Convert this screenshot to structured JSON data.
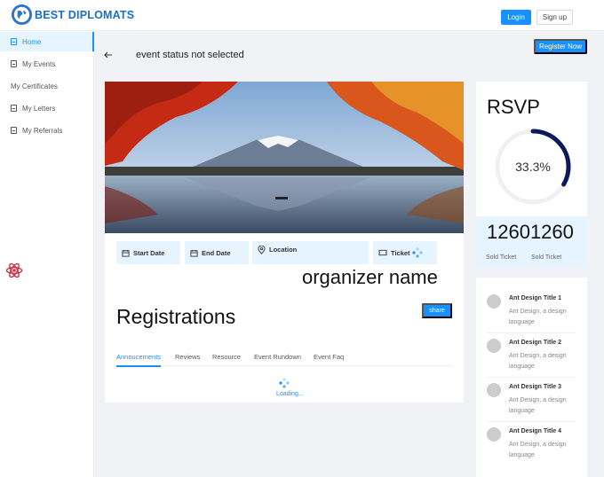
{
  "header": {
    "brand": "BEST DIPLOMATS",
    "login_label": "Login",
    "signup_label": "Sign up"
  },
  "sidebar": {
    "items": [
      {
        "label": "Home",
        "icon": "document-icon",
        "active": true
      },
      {
        "label": "My Events",
        "icon": "document-icon",
        "active": false
      },
      {
        "label": "My Certificates",
        "icon": "",
        "active": false
      },
      {
        "label": "My Letters",
        "icon": "document-icon",
        "active": false
      },
      {
        "label": "My Referrals",
        "icon": "document-icon",
        "active": false
      }
    ]
  },
  "page": {
    "register_label": "Register Now",
    "status_title": "event status not selected"
  },
  "event": {
    "chips": {
      "start_date": "Start Date",
      "end_date": "End Date",
      "location": "Location",
      "ticket": "Ticket"
    },
    "organizer": "organizer name",
    "registrations_title": "Registrations",
    "share_label": "share",
    "tabs": [
      "Annoucements",
      "Reviews",
      "Resource",
      "Event Rundown",
      "Event Faq"
    ],
    "active_tab": "Annoucements",
    "loading_text": "Loading..."
  },
  "rsvp": {
    "title": "RSVP",
    "percent_label": "33.3%",
    "percent_value": 33.3,
    "big_number": "12601260",
    "sold_labels": [
      "Sold Ticket",
      "Sold Ticket"
    ]
  },
  "list": {
    "items": [
      {
        "title": "Ant Design Title 1",
        "description": "Ant Design, a design language"
      },
      {
        "title": "Ant Design Title 2",
        "description": "Ant Design, a design language"
      },
      {
        "title": "Ant Design Title 3",
        "description": "Ant Design, a design language"
      },
      {
        "title": "Ant Design Title 4",
        "description": "Ant Design, a design language"
      }
    ]
  },
  "colors": {
    "accent": "#1890ff",
    "accent_light": "#e6f4ff",
    "ring_track": "#f0f0f0",
    "ring_fill": "#0a1a5c"
  }
}
